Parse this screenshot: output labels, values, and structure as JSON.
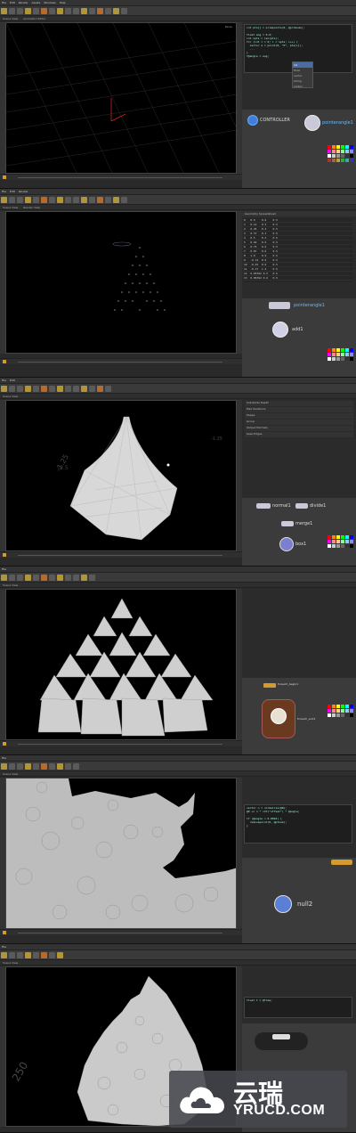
{
  "app": {
    "menu": [
      "File",
      "Edit",
      "Render",
      "Assets",
      "Windows",
      "Help",
      "Build"
    ],
    "tabs": [
      "Scene View",
      "Animation Editor",
      "Render View",
      "Composite View"
    ],
    "frame": "1"
  },
  "panels": [
    {
      "id": "panel1",
      "viewport_label": "Persp",
      "code": "int pts[] = primpoints(0, @primnum);\n\nfloat ang = 0.0;\nint npts = len(pts);\nfor (int i = 0; i < npts; i++) {\n  vector a = point(0, \"P\", pts[i]);\n  ...\n}\nf@angle = ang;",
      "code_menu": [
        "int",
        "float",
        "vector",
        "string",
        "matrix"
      ],
      "nodes": [
        {
          "name": "CONTROLLER"
        },
        {
          "name": "pointerangle1"
        }
      ]
    },
    {
      "id": "panel2",
      "viewport_label": "Persp",
      "spreadsheet_title": "Geometry Spreadsheet",
      "spreadsheet_rows": [
        "0   0.0    0.0    0.5",
        "1   0.12   0.3    0.5",
        "2   0.25   0.3    0.5",
        "3   0.37   0.3    0.5",
        "4   0.5    0.3    0.5",
        "5   0.62   0.6    0.5",
        "6   0.75   0.6    0.5",
        "7   0.87   0.6    0.5",
        "8   1.0    0.9    0.5",
        "9   -0.12  0.9    0.5",
        "10  -0.25  0.9    0.5",
        "11  -0.37  1.2    0.5",
        "12  0.05392 0.5   0.5",
        "13  0.05392 0.6   0.5"
      ],
      "nodes": [
        {
          "name": "pointerangle1"
        },
        {
          "name": "add1"
        }
      ]
    },
    {
      "id": "panel3",
      "viewport_label": "Persp",
      "axis_label": "-1.25",
      "axis_label2": "-2.5",
      "params": [
        "Subdivide Depth",
        "Max Iterations",
        "Shape",
        "Group",
        "Output Normals",
        "Keep Edges"
      ],
      "nodes": [
        {
          "name": "normal1"
        },
        {
          "name": "divide1"
        },
        {
          "name": "merge1"
        },
        {
          "name": "box1"
        }
      ]
    },
    {
      "id": "panel4",
      "viewport_label": "Persp",
      "nodes": [
        {
          "name": "foreach_begin1"
        },
        {
          "name": "foreach_end1"
        }
      ]
    },
    {
      "id": "panel5",
      "viewport_label": "Persp",
      "code": "vector n = normalize(@N);\n@P += n * chf(\"offset\") * @angle;\n\nif (@angle < 0.0001) {\n  removepoint(0, @ptnum);\n}",
      "nodes": [
        {
          "name": "null2"
        }
      ]
    },
    {
      "id": "panel6",
      "viewport_label": "Persp",
      "axis_label": "250",
      "code": "float t = @Time;",
      "nodes": []
    }
  ],
  "watermark": {
    "cn": "云瑞",
    "en": "YRUCD.COM"
  },
  "colors": {
    "accent": "#d49a2b",
    "node_blue": "#3f7fd9",
    "geometry": "#cfcfcf"
  }
}
